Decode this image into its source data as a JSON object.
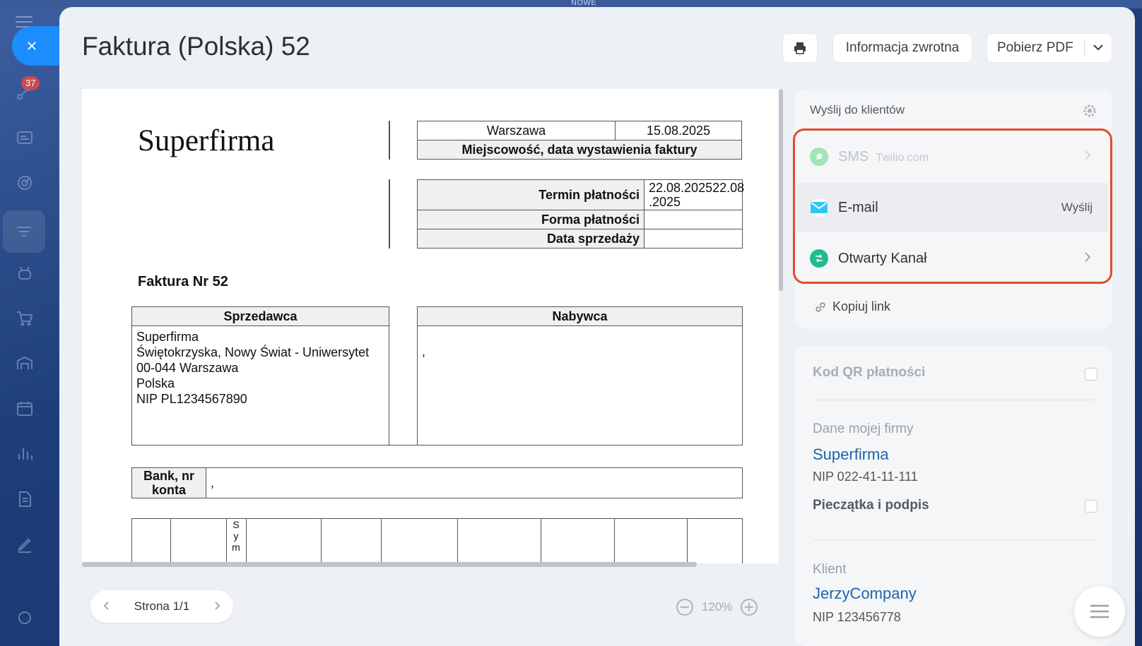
{
  "window": {
    "top_label": "NOWE"
  },
  "sidebar": {
    "badge_count": "37"
  },
  "header": {
    "title": "Faktura (Polska) 52",
    "print_icon": "printer-icon",
    "feedback_label": "Informacja zwrotna",
    "pdf_label": "Pobierz PDF"
  },
  "document": {
    "company": "Superfirma",
    "city": "Warszawa",
    "date": "15.08.2025",
    "place_date_label": "Miejscowość, data wystawienia faktury",
    "due_label": "Termin płatności",
    "due_value_1": "22.08.202522.08",
    "due_value_2": ".2025",
    "payment_form_label": "Forma płatności",
    "sale_date_label": "Data sprzedaży",
    "invoice_no": "Faktura Nr 52",
    "seller_label": "Sprzedawca",
    "buyer_label": "Nabywca",
    "seller_lines": [
      "Superfirma",
      "Świętokrzyska, Nowy Świat - Uniwersytet",
      "00-044 Warszawa",
      "Polska",
      "NIP PL1234567890"
    ],
    "buyer_value": ",",
    "bank_label_1": "Bank, nr",
    "bank_label_2": "konta",
    "bank_value": ",",
    "sym_letters": [
      "S",
      "y",
      "m"
    ]
  },
  "pager": {
    "label": "Strona 1/1"
  },
  "zoom": {
    "level": "120%"
  },
  "send_panel": {
    "title": "Wyślij do klientów",
    "channels": [
      {
        "label": "SMS",
        "sub": "Twilio.com",
        "icon": "whatsapp-icon",
        "color": "#3ccf6a"
      },
      {
        "label": "E-mail",
        "action": "Wyślij",
        "icon": "email-icon",
        "color": "#2fc6f6"
      },
      {
        "label": "Otwarty Kanał",
        "icon": "open-channel-icon",
        "color": "#1ebc8f"
      }
    ],
    "copy_link": "Kopiuj link"
  },
  "settings_panel": {
    "qr_label": "Kod QR płatności",
    "my_company_label": "Dane mojej firmy",
    "my_company_name": "Superfirma",
    "my_company_nip": "NIP 022-41-11-111",
    "stamp_label": "Pieczątka i podpis",
    "client_label": "Klient",
    "client_name": "JerzyCompany",
    "client_nip": "NIP 123456778"
  },
  "colors": {
    "accent": "#1b8dff",
    "highlight": "#e04d2c",
    "link": "#1f64ad"
  }
}
